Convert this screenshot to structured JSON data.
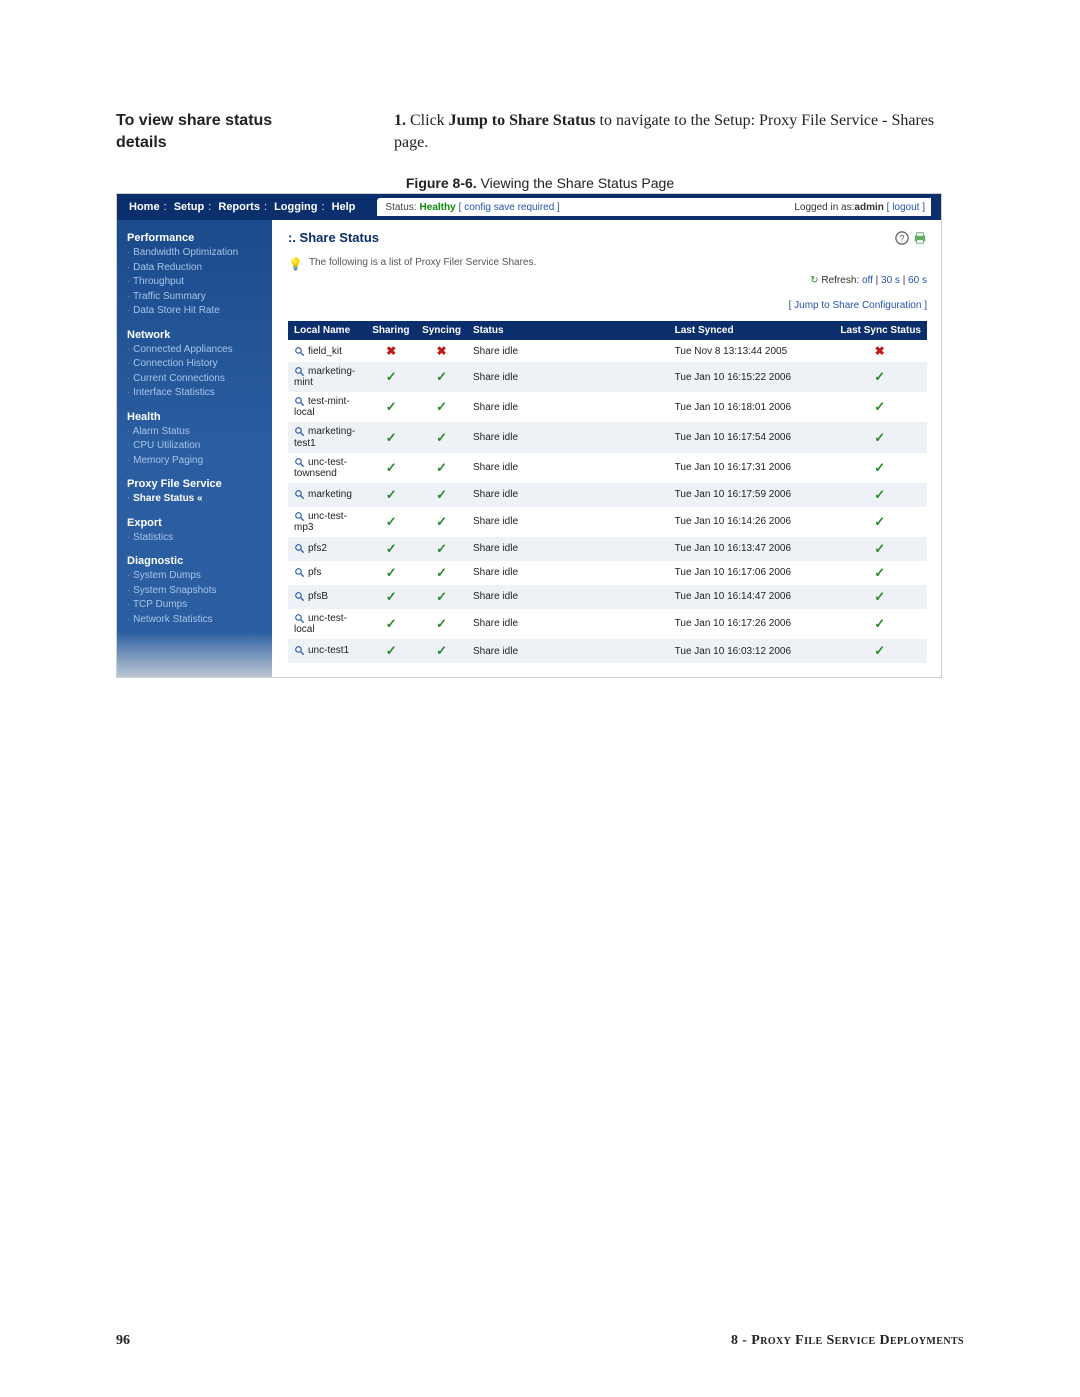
{
  "doc": {
    "instr_title_l1": "To view share status",
    "instr_title_l2": "details",
    "step_num": "1.",
    "step_text_prefix": " Click ",
    "step_bold": "Jump to Share Status",
    "step_text_suffix": " to navigate to the Setup: Proxy File Service - Shares page.",
    "figure_label_bold": "Figure 8-6.",
    "figure_label_rest": " Viewing the Share Status Page",
    "page_number": "96",
    "chapter": "8 - Proxy File Service Deployments"
  },
  "nav": {
    "items": [
      "Home",
      "Setup",
      "Reports",
      "Logging",
      "Help"
    ],
    "status_label": "Status:",
    "status_value": "Healthy",
    "status_note": "[ config save required ]",
    "login_prefix": "Logged in as: ",
    "login_user": "admin",
    "logout": "[ logout ]"
  },
  "sidebar": {
    "groups": [
      {
        "title": "Performance",
        "items": [
          "Bandwidth Optimization",
          "Data Reduction",
          "Throughput",
          "Traffic Summary",
          "Data Store Hit Rate"
        ]
      },
      {
        "title": "Network",
        "items": [
          "Connected Appliances",
          "Connection History",
          "Current Connections",
          "Interface Statistics"
        ]
      },
      {
        "title": "Health",
        "items": [
          "Alarm Status",
          "CPU Utilization",
          "Memory Paging"
        ]
      },
      {
        "title": "Proxy File Service",
        "items": [
          "Share Status «"
        ],
        "active": 0
      },
      {
        "title": "Export",
        "items": [
          "Statistics"
        ]
      },
      {
        "title": "Diagnostic",
        "items": [
          "System Dumps",
          "System Snapshots",
          "TCP Dumps",
          "Network Statistics"
        ]
      }
    ]
  },
  "main": {
    "page_title": ":. Share Status",
    "tip": "The following is a list of Proxy Filer Service Shares.",
    "refresh_label": "Refresh:",
    "refresh_off": " off",
    "refresh_30": "30 s",
    "refresh_60": "60 s",
    "jump_link": "[ Jump to Share Configuration ]",
    "columns": {
      "local_name": "Local Name",
      "sharing": "Sharing",
      "syncing": "Syncing",
      "status": "Status",
      "last_synced": "Last Synced",
      "last_sync_status": "Last Sync Status"
    },
    "rows": [
      {
        "name": "field_kit",
        "sharing": "x",
        "syncing": "x",
        "status": "Share idle",
        "last": "Tue Nov 8 13:13:44 2005",
        "lss": "x"
      },
      {
        "name": "marketing-mint",
        "sharing": "chk",
        "syncing": "chk",
        "status": "Share idle",
        "last": "Tue Jan 10 16:15:22 2006",
        "lss": "chk"
      },
      {
        "name": "test-mint-local",
        "sharing": "chk",
        "syncing": "chk",
        "status": "Share idle",
        "last": "Tue Jan 10 16:18:01 2006",
        "lss": "chk"
      },
      {
        "name": "marketing-test1",
        "sharing": "chk",
        "syncing": "chk",
        "status": "Share idle",
        "last": "Tue Jan 10 16:17:54 2006",
        "lss": "chk"
      },
      {
        "name": "unc-test-townsend",
        "sharing": "chk",
        "syncing": "chk",
        "status": "Share idle",
        "last": "Tue Jan 10 16:17:31 2006",
        "lss": "chk"
      },
      {
        "name": "marketing",
        "sharing": "chk",
        "syncing": "chk",
        "status": "Share idle",
        "last": "Tue Jan 10 16:17:59 2006",
        "lss": "chk"
      },
      {
        "name": "unc-test-mp3",
        "sharing": "chk",
        "syncing": "chk",
        "status": "Share idle",
        "last": "Tue Jan 10 16:14:26 2006",
        "lss": "chk"
      },
      {
        "name": "pfs2",
        "sharing": "chk",
        "syncing": "chk",
        "status": "Share idle",
        "last": "Tue Jan 10 16:13:47 2006",
        "lss": "chk"
      },
      {
        "name": "pfs",
        "sharing": "chk",
        "syncing": "chk",
        "status": "Share idle",
        "last": "Tue Jan 10 16:17:06 2006",
        "lss": "chk"
      },
      {
        "name": "pfsB",
        "sharing": "chk",
        "syncing": "chk",
        "status": "Share idle",
        "last": "Tue Jan 10 16:14:47 2006",
        "lss": "chk"
      },
      {
        "name": "unc-test-local",
        "sharing": "chk",
        "syncing": "chk",
        "status": "Share idle",
        "last": "Tue Jan 10 16:17:26 2006",
        "lss": "chk"
      },
      {
        "name": "unc-test1",
        "sharing": "chk",
        "syncing": "chk",
        "status": "Share idle",
        "last": "Tue Jan 10 16:03:12 2006",
        "lss": "chk"
      }
    ]
  },
  "glyphs": {
    "check": "✓",
    "cross": "✖",
    "bulb": "💡",
    "refresh": "↻"
  }
}
